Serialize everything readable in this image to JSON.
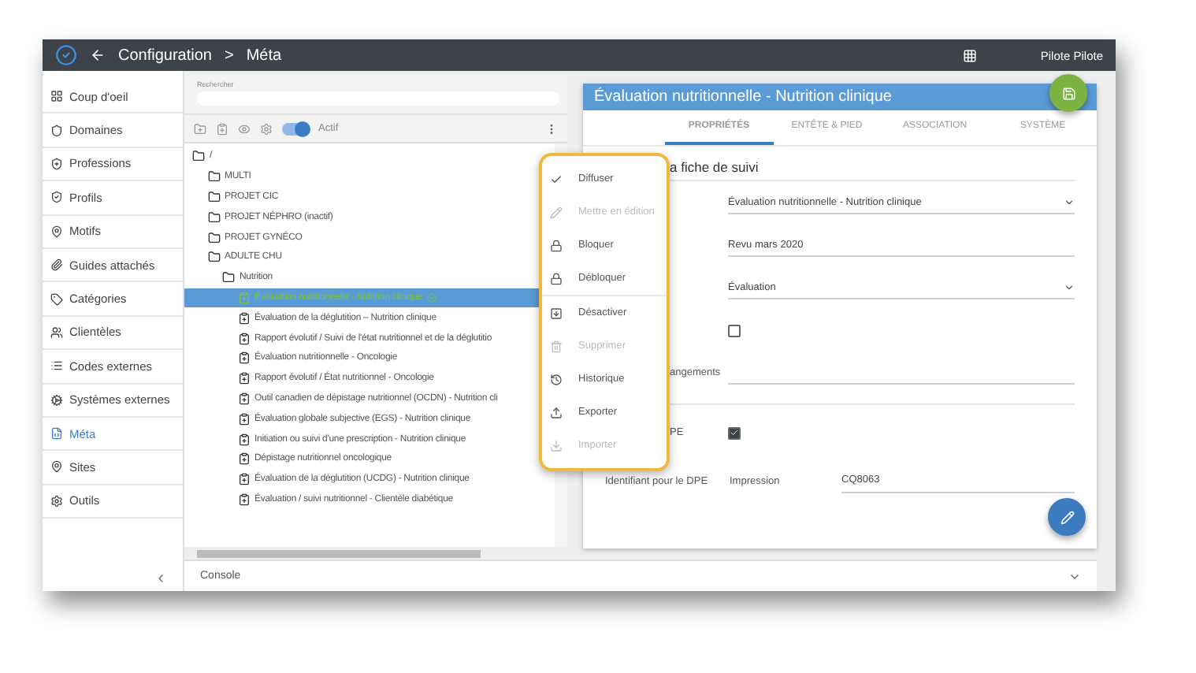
{
  "header": {
    "breadcrumb": [
      "Configuration",
      "Méta"
    ],
    "separator": ">",
    "user": "Pilote Pilote"
  },
  "sidebar": {
    "items": [
      {
        "label": "Coup d'oeil",
        "selected": false
      },
      {
        "label": "Domaines",
        "selected": false
      },
      {
        "label": "Professions",
        "selected": false
      },
      {
        "label": "Profils",
        "selected": false
      },
      {
        "label": "Motifs",
        "selected": false
      },
      {
        "label": "Guides attachés",
        "selected": false
      },
      {
        "label": "Catégories",
        "selected": false
      },
      {
        "label": "Clientèles",
        "selected": false
      },
      {
        "label": "Codes externes",
        "selected": false
      },
      {
        "label": "Systèmes externes",
        "selected": false
      },
      {
        "label": "Méta",
        "selected": true
      },
      {
        "label": "Sites",
        "selected": false
      },
      {
        "label": "Outils",
        "selected": false
      }
    ]
  },
  "search": {
    "label": "Rechercher"
  },
  "toolbar": {
    "active_toggle": {
      "on": true,
      "label": "Actif"
    }
  },
  "tree": [
    {
      "kind": "folder",
      "label": "/",
      "selected": false,
      "children": [
        {
          "kind": "folder",
          "label": "MULTI",
          "selected": false
        },
        {
          "kind": "folder",
          "label": "PROJET CIC",
          "selected": false
        },
        {
          "kind": "folder",
          "label": "PROJET NÉPHRO (inactif)",
          "selected": false
        },
        {
          "kind": "folder",
          "label": "PROJET GYNÉCO",
          "selected": false
        },
        {
          "kind": "folder",
          "label": "ADULTE CHU",
          "selected": false,
          "children": [
            {
              "kind": "folder",
              "label": "Nutrition",
              "selected": false,
              "children": [
                {
                  "kind": "form",
                  "label": "Évaluation nutritionnelle - Nutrition clinique",
                  "selected": true
                },
                {
                  "kind": "form",
                  "label": "Évaluation de la déglutition – Nutrition clinique",
                  "selected": false
                },
                {
                  "kind": "form",
                  "label": "Rapport évolutif / Suivi de l'état nutritionnel et de la déglutitio",
                  "selected": false
                },
                {
                  "kind": "form",
                  "label": "Évaluation nutritionnelle - Oncologie",
                  "selected": false
                },
                {
                  "kind": "form",
                  "label": "Rapport évolutif / État nutritionnel - Oncologie",
                  "selected": false
                },
                {
                  "kind": "form",
                  "label": "Outil canadien de dépistage nutritionnel (OCDN) - Nutrition cli",
                  "selected": false
                },
                {
                  "kind": "form",
                  "label": "Évaluation globale subjective (EGS) - Nutrition clinique",
                  "selected": false
                },
                {
                  "kind": "form",
                  "label": "Initiation ou suivi d'une prescription - Nutrition clinique",
                  "selected": false
                },
                {
                  "kind": "form",
                  "label": "Dépistage nutritionnel oncologique",
                  "selected": false
                },
                {
                  "kind": "form",
                  "label": "Évaluation de la déglutition (UCDG) - Nutrition clinique",
                  "selected": false
                },
                {
                  "kind": "form",
                  "label": "Évaluation / suivi nutritionnel - Clientèle diabétique",
                  "selected": false
                }
              ]
            }
          ]
        }
      ]
    }
  ],
  "menu": {
    "groups": [
      [
        {
          "label": "Diffuser",
          "disabled": false
        },
        {
          "label": "Mettre en édition",
          "disabled": true
        },
        {
          "label": "Bloquer",
          "disabled": false
        },
        {
          "label": "Débloquer",
          "disabled": false
        }
      ],
      [
        {
          "label": "Désactiver",
          "disabled": false
        },
        {
          "label": "Supprimer",
          "disabled": true
        },
        {
          "label": "Historique",
          "disabled": false
        },
        {
          "label": "Exporter",
          "disabled": false
        },
        {
          "label": "Importer",
          "disabled": true
        }
      ]
    ]
  },
  "detail": {
    "title": "Évaluation nutritionnelle - Nutrition clinique",
    "tabs": [
      {
        "label": "PROPRIÉTÉS",
        "selected": true
      },
      {
        "label": "ENTÊTE & PIED",
        "selected": false
      },
      {
        "label": "ASSOCIATION",
        "selected": false
      },
      {
        "label": "SYSTÈME",
        "selected": false
      }
    ],
    "section_title": "a fiche de suivi",
    "fields": [
      {
        "kind": "select",
        "value": "Évaluation nutritionnelle - Nutrition clinique"
      },
      {
        "kind": "text",
        "value": "Revu mars 2020"
      },
      {
        "kind": "select",
        "value": "Évaluation"
      },
      {
        "kind": "checkbox",
        "checked": false
      },
      {
        "kind": "text",
        "label": "angements"
      }
    ],
    "dpe": {
      "label": "PE",
      "checked": true
    },
    "identifier": {
      "label": "Identifiant pour le DPE",
      "sublabel": "Impression",
      "value": "CQ8063"
    }
  },
  "console": {
    "label": "Console"
  }
}
